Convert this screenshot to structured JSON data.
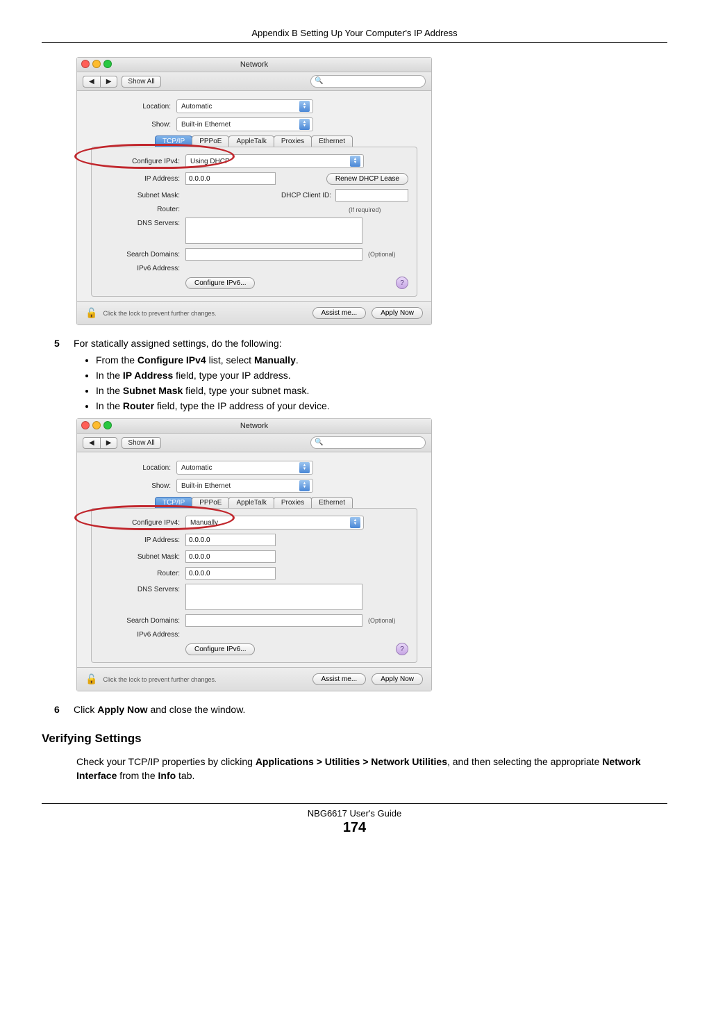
{
  "header": "Appendix B Setting Up Your Computer's IP Address",
  "footer": {
    "book": "NBG6617 User's Guide",
    "page": "174"
  },
  "mac_common": {
    "title": "Network",
    "back": "◀",
    "fwd": "▶",
    "show_all": "Show All",
    "search_placeholder": "",
    "labels": {
      "location": "Location:",
      "show": "Show:",
      "configure_ipv4": "Configure IPv4:",
      "ip_address": "IP Address:",
      "subnet_mask": "Subnet Mask:",
      "router": "Router:",
      "dns_servers": "DNS Servers:",
      "search_domains": "Search Domains:",
      "ipv6_address": "IPv6 Address:",
      "dhcp_client_id": "DHCP Client ID:"
    },
    "values": {
      "location": "Automatic",
      "show": "Built-in Ethernet"
    },
    "tabs": [
      "TCP/IP",
      "PPPoE",
      "AppleTalk",
      "Proxies",
      "Ethernet"
    ],
    "buttons": {
      "renew_dhcp": "Renew DHCP Lease",
      "configure_ipv6": "Configure IPv6...",
      "assist_me": "Assist me...",
      "apply_now": "Apply Now"
    },
    "hints": {
      "if_required": "(If required)",
      "optional": "(Optional)",
      "lock_text": "Click the lock to prevent further changes."
    }
  },
  "win1": {
    "configure_ipv4": "Using DHCP",
    "ip_address": "0.0.0.0"
  },
  "win2": {
    "configure_ipv4": "Manually",
    "ip_address": "0.0.0.0",
    "subnet_mask": "0.0.0.0",
    "router": "0.0.0.0"
  },
  "steps": {
    "s5num": "5",
    "s5text": "For statically assigned settings, do the following:",
    "s5bullets": [
      {
        "pre": "From the ",
        "b": "Configure IPv4",
        "mid": " list, select ",
        "b2": "Manually",
        "post": "."
      },
      {
        "pre": "In the ",
        "b": "IP Address",
        "mid": " field, type your IP address.",
        "b2": "",
        "post": ""
      },
      {
        "pre": "In the ",
        "b": "Subnet Mask",
        "mid": " field, type your subnet mask.",
        "b2": "",
        "post": ""
      },
      {
        "pre": "In the ",
        "b": "Router",
        "mid": " field, type the IP address of your device.",
        "b2": "",
        "post": ""
      }
    ],
    "s6num": "6",
    "s6pre": "Click ",
    "s6b": "Apply Now",
    "s6post": " and close the window."
  },
  "verify": {
    "heading": "Verifying Settings",
    "p1": "Check your TCP/IP properties by clicking ",
    "b1": "Applications > Utilities > Network Utilities",
    "p2": ", and then selecting the appropriate ",
    "b2": "Network Interface",
    "p3": " from the ",
    "b3": "Info",
    "p4": " tab."
  }
}
